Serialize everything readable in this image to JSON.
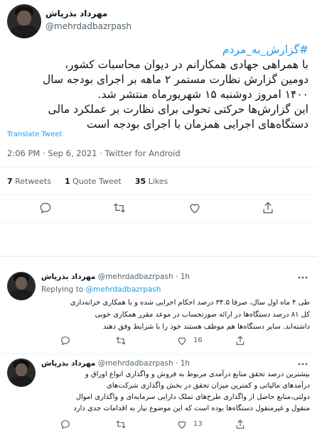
{
  "main_tweet": {
    "author_name": "مهرداد بذرپاش",
    "author_handle": "@mehrdadbazrpash",
    "hashtag": "#گزارش_به_مردم",
    "body_lines": [
      "با همراهی جهادی همکارانم در دیوان محاسبات کشور،",
      "دومین گزارش نظارت مستمر ۲ ماهه بر اجرای بودجه سال",
      "۱۴۰۰ امروز دوشنبه ۱۵ شهریورماه منتشر شد.",
      "این گزارش‌ها حرکتی تحولی برای نظارت بر عملکرد مالی",
      "دستگاه‌های اجرایی همزمان با اجرای بودجه است"
    ],
    "translate_label": "Translate Tweet",
    "timestamp": "2:06 PM · Sep 6, 2021 · Twitter for Android",
    "stats": {
      "retweets_count": "7",
      "retweets_label": "Retweets",
      "quotes_count": "1",
      "quotes_label": "Quote Tweet",
      "likes_count": "35",
      "likes_label": "Likes"
    }
  },
  "replies": [
    {
      "author_name": "مهرداد بذرپاش",
      "author_handle": "@mehrdadbazrpash",
      "time": "· 1h",
      "replying_prefix": "Replying to",
      "replying_handle": "@mehrdadbazrpash",
      "body_lines": [
        "طی ۴ ماه اول سال، صرفا ۳۴.۵ درصد احکام اجرایی شده و با همکاری خزانه‌داری",
        "کل ۸۱ درصد دستگاه‌ها در ارائه صورتحساب در موعد مقرر همکاری خوبی",
        "داشته‌اند. سایر دستگاه‌ها هم موظف هستند خود را با شرایط وفق دهند"
      ],
      "likes_count": "16"
    },
    {
      "author_name": "مهرداد بذرپاش",
      "author_handle": "@mehrdadbazrpash",
      "time": "· 1h",
      "body_lines": [
        "بیشترین درصد تحقق منابع درآمدی مربوط به فروش و واگذاری انواع اوراق و",
        "درآمدهای مالیاتی و کمترین میزان تحقق در بخش واگذاری شرکت‌های",
        "دولتی،منابع حاصل از واگذاری طرح‌های تملک دارایی سرمایه‌ای و واگذاری اموال",
        "منقول و غیرمنقول دستگاه‌ها بوده است که این موضوع نیاز به اقدامات جدی دارد"
      ],
      "likes_count": "13"
    }
  ],
  "colors": {
    "accent": "#1d9bf0",
    "text": "#0f1419",
    "muted": "#536471",
    "divider": "#eff3f4"
  },
  "icons": [
    "reply-icon",
    "retweet-icon",
    "like-icon",
    "share-icon",
    "more-icon"
  ]
}
